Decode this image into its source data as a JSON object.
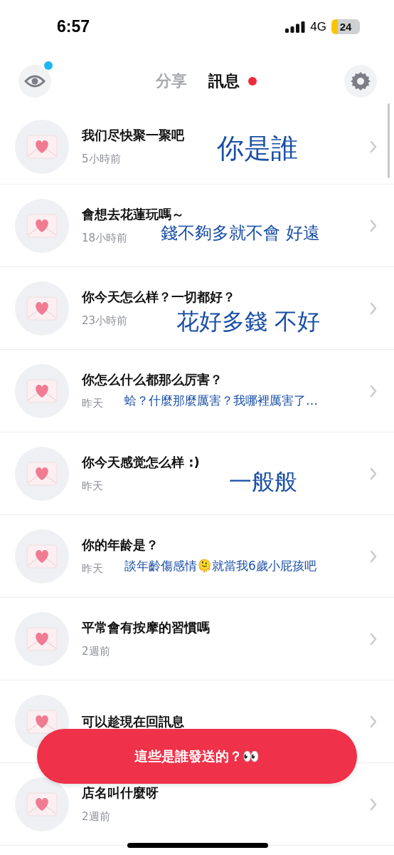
{
  "status_bar": {
    "time": "6:57",
    "network": "4G",
    "battery": "24"
  },
  "tabs": [
    {
      "label": "分享",
      "selected": false,
      "badge": false
    },
    {
      "label": "訊息",
      "selected": true,
      "badge": true
    }
  ],
  "eye_button": {
    "badge": true
  },
  "messages": [
    {
      "text": "我们尽快聚一聚吧",
      "time": "5小時前",
      "note": {
        "text": "你是誰",
        "kind": "large"
      }
    },
    {
      "text": "會想去花蓮玩嗎～",
      "time": "18小時前",
      "note": {
        "text": "錢不夠多就不會 好遠",
        "kind": "medium"
      }
    },
    {
      "text": "你今天怎么样？一切都好？",
      "time": "23小時前",
      "note": {
        "text": "花好多錢 不好",
        "kind": "large2"
      }
    },
    {
      "text": "你怎么什么都那么厉害？",
      "time": "昨天",
      "note": {
        "text": "蛤？什麼那麼厲害？我哪裡厲害了…",
        "kind": "small"
      }
    },
    {
      "text": "你今天感觉怎么样 :)",
      "time": "昨天",
      "note": {
        "text": "一般般",
        "kind": "large3"
      }
    },
    {
      "text": "你的年龄是？",
      "time": "昨天",
      "note": {
        "text": "談年齡傷感情🫠就當我6歲小屁孩吧",
        "kind": "small"
      }
    },
    {
      "text": "平常會有按摩的習慣嗎",
      "time": "2週前"
    },
    {
      "text": "可以趁現在回訊息"
    },
    {
      "text": "店名叫什麼呀",
      "time": "2週前"
    }
  ],
  "action_button": {
    "label": "這些是誰發送的？👀"
  }
}
